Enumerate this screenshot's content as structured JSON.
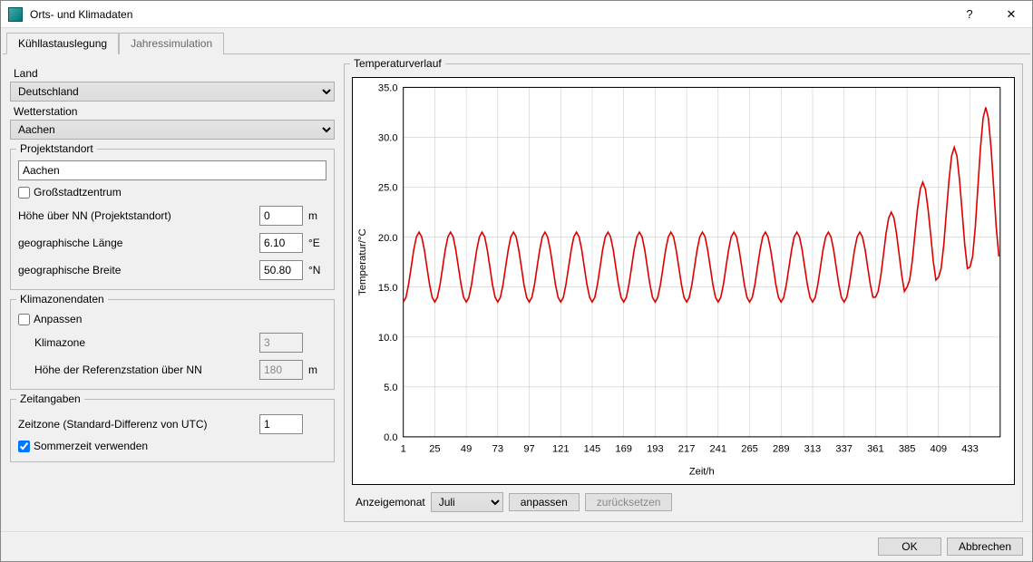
{
  "window": {
    "title": "Orts- und Klimadaten"
  },
  "tabs": {
    "cooling": "Kühllastauslegung",
    "annual": "Jahressimulation"
  },
  "left": {
    "land_label": "Land",
    "land_value": "Deutschland",
    "station_label": "Wetterstation",
    "station_value": "Aachen",
    "project": {
      "title": "Projektstandort",
      "name_value": "Aachen",
      "bigcity_label": "Großstadtzentrum",
      "bigcity_checked": false,
      "height_label": "Höhe über NN (Projektstandort)",
      "height_value": "0",
      "height_unit": "m",
      "lon_label": "geographische Länge",
      "lon_value": "6.10",
      "lon_unit": "°E",
      "lat_label": "geographische Breite",
      "lat_value": "50.80",
      "lat_unit": "°N"
    },
    "climate": {
      "title": "Klimazonendaten",
      "adjust_label": "Anpassen",
      "adjust_checked": false,
      "zone_label": "Klimazone",
      "zone_value": "3",
      "refheight_label": "Höhe der Referenzstation über NN",
      "refheight_value": "180",
      "refheight_unit": "m"
    },
    "time": {
      "title": "Zeitangaben",
      "tz_label": "Zeitzone (Standard-Differenz von UTC)",
      "tz_value": "1",
      "dst_label": "Sommerzeit verwenden",
      "dst_checked": true
    }
  },
  "right": {
    "title": "Temperaturverlauf",
    "controls": {
      "month_label": "Anzeigemonat",
      "month_value": "Juli",
      "adjust_btn": "anpassen",
      "reset_btn": "zurücksetzen"
    }
  },
  "footer": {
    "ok": "OK",
    "cancel": "Abbrechen"
  },
  "chart_data": {
    "type": "line",
    "title": "Temperaturverlauf",
    "xlabel": "Zeit/h",
    "ylabel": "Temperatur/°C",
    "x_ticks": [
      1,
      25,
      49,
      73,
      97,
      121,
      145,
      169,
      193,
      217,
      241,
      265,
      289,
      313,
      337,
      361,
      385,
      409,
      433
    ],
    "xlim": [
      1,
      456
    ],
    "ylim": [
      0,
      35
    ],
    "y_ticks": [
      0,
      5,
      10,
      15,
      20,
      25,
      30,
      35
    ],
    "series": [
      {
        "name": "Temperatur",
        "color": "#e00000",
        "period_h": 24,
        "cycles": [
          {
            "hour_start": 1,
            "min": 13.5,
            "max": 20.5
          },
          {
            "hour_start": 25,
            "min": 13.5,
            "max": 20.5
          },
          {
            "hour_start": 49,
            "min": 13.5,
            "max": 20.5
          },
          {
            "hour_start": 73,
            "min": 13.5,
            "max": 20.5
          },
          {
            "hour_start": 97,
            "min": 13.5,
            "max": 20.5
          },
          {
            "hour_start": 121,
            "min": 13.5,
            "max": 20.5
          },
          {
            "hour_start": 145,
            "min": 13.5,
            "max": 20.5
          },
          {
            "hour_start": 169,
            "min": 13.5,
            "max": 20.5
          },
          {
            "hour_start": 193,
            "min": 13.5,
            "max": 20.5
          },
          {
            "hour_start": 217,
            "min": 13.5,
            "max": 20.5
          },
          {
            "hour_start": 241,
            "min": 13.5,
            "max": 20.5
          },
          {
            "hour_start": 265,
            "min": 13.5,
            "max": 20.5
          },
          {
            "hour_start": 289,
            "min": 13.5,
            "max": 20.5
          },
          {
            "hour_start": 313,
            "min": 13.5,
            "max": 20.5
          },
          {
            "hour_start": 337,
            "min": 13.5,
            "max": 20.5
          },
          {
            "hour_start": 361,
            "min": 14.0,
            "max": 22.5
          },
          {
            "hour_start": 385,
            "min": 15.0,
            "max": 25.5
          },
          {
            "hour_start": 409,
            "min": 16.0,
            "max": 29.0
          },
          {
            "hour_start": 433,
            "min": 17.0,
            "max": 33.0
          }
        ]
      }
    ]
  }
}
